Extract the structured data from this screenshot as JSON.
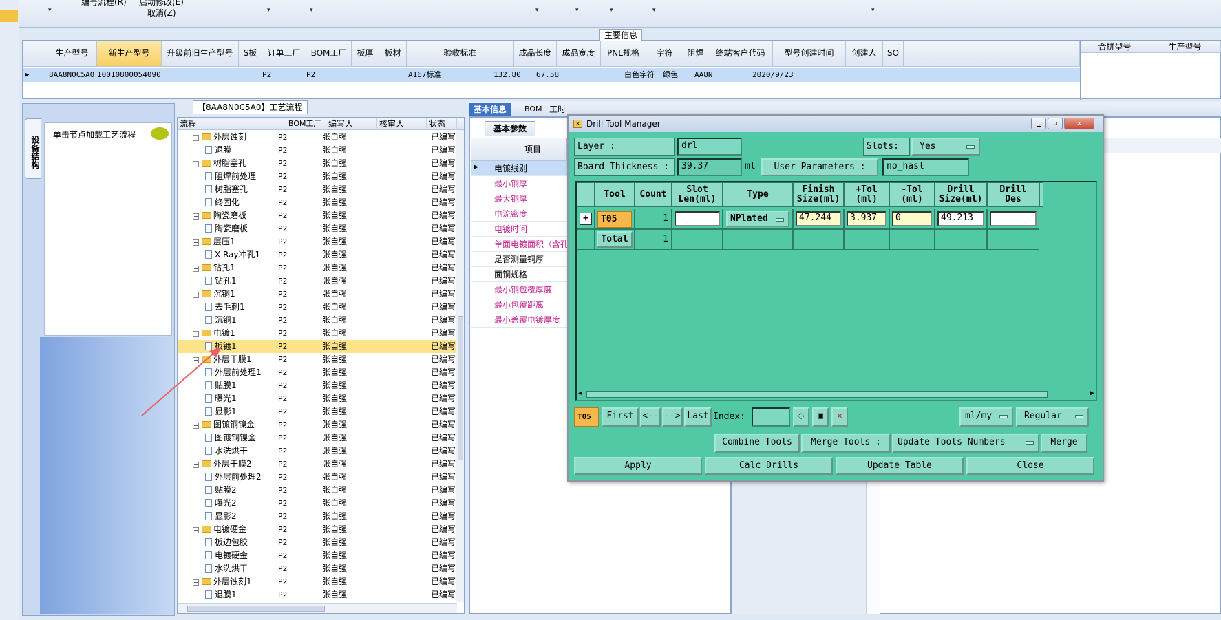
{
  "top": {
    "labels": [
      "编号流程(R)",
      "启动修改(E)",
      "取消(Z)"
    ]
  },
  "main_info": {
    "title": "主要信息",
    "columns": [
      "生产型号",
      "新生产型号",
      "升级前旧生产型号",
      "S板",
      "订单工厂",
      "BOM工厂",
      "板厚",
      "板材",
      "验收标准",
      "成品长度",
      "成品宽度",
      "PNL规格",
      "字符",
      "阻焊",
      "终端客户代码",
      "型号创建时间",
      "创建人",
      "SO"
    ],
    "row": {
      "model": "8AA8N0C5A0",
      "new_model": "10010800054090",
      "order_factory": "P2",
      "bom_factory": "P2",
      "standard": "A167标准",
      "length": "132.80",
      "width": "67.58",
      "char": "白色字符",
      "solder": "绿色",
      "customer": "AA8N",
      "created": "2020/9/23"
    },
    "right_columns": [
      "合拼型号",
      "生产型号"
    ]
  },
  "left_panel": {
    "vtab": "设备结构",
    "hint": "单击节点加载工艺流程"
  },
  "process": {
    "title": "【8AA8N0C5A0】工艺流程",
    "headers": [
      "流程",
      "BOM工厂",
      "编写人",
      "核审人",
      "状态"
    ],
    "rows": [
      {
        "name": "外层蚀刻",
        "level": 1,
        "factory": "P2",
        "writer": "张自强",
        "status": "已编写"
      },
      {
        "name": "退膜",
        "level": 2,
        "factory": "P2",
        "writer": "张自强",
        "status": "已编写"
      },
      {
        "name": "树脂塞孔",
        "level": 1,
        "factory": "P2",
        "writer": "张自强",
        "status": "已编写"
      },
      {
        "name": "阻焊前处理",
        "level": 2,
        "factory": "P2",
        "writer": "张自强",
        "status": "已编写"
      },
      {
        "name": "树脂塞孔",
        "level": 2,
        "factory": "P2",
        "writer": "张自强",
        "status": "已编写"
      },
      {
        "name": "终固化",
        "level": 2,
        "factory": "P2",
        "writer": "张自强",
        "status": "已编写"
      },
      {
        "name": "陶瓷磨板",
        "level": 1,
        "factory": "P2",
        "writer": "张自强",
        "status": "已编写"
      },
      {
        "name": "陶瓷磨板",
        "level": 2,
        "factory": "P2",
        "writer": "张自强",
        "status": "已编写"
      },
      {
        "name": "层压1",
        "level": 1,
        "factory": "P2",
        "writer": "张自强",
        "status": "已编写"
      },
      {
        "name": "X-Ray冲孔1",
        "level": 2,
        "factory": "P2",
        "writer": "张自强",
        "status": "已编写"
      },
      {
        "name": "钻孔1",
        "level": 1,
        "factory": "P2",
        "writer": "张自强",
        "status": "已编写"
      },
      {
        "name": "钻孔1",
        "level": 2,
        "factory": "P2",
        "writer": "张自强",
        "status": "已编写"
      },
      {
        "name": "沉铜1",
        "level": 1,
        "factory": "P2",
        "writer": "张自强",
        "status": "已编写"
      },
      {
        "name": "去毛刺1",
        "level": 2,
        "factory": "P2",
        "writer": "张自强",
        "status": "已编写"
      },
      {
        "name": "沉铜1",
        "level": 2,
        "factory": "P2",
        "writer": "张自强",
        "status": "已编写"
      },
      {
        "name": "电镀1",
        "level": 1,
        "factory": "P2",
        "writer": "张自强",
        "status": "已编写"
      },
      {
        "name": "板镀1",
        "level": 2,
        "factory": "P2",
        "writer": "张自强",
        "status": "已编写",
        "selected": true
      },
      {
        "name": "外层干膜1",
        "level": 1,
        "factory": "P2",
        "writer": "张自强",
        "status": "已编写"
      },
      {
        "name": "外层前处理1",
        "level": 2,
        "factory": "P2",
        "writer": "张自强",
        "status": "已编写"
      },
      {
        "name": "贴膜1",
        "level": 2,
        "factory": "P2",
        "writer": "张自强",
        "status": "已编写"
      },
      {
        "name": "曝光1",
        "level": 2,
        "factory": "P2",
        "writer": "张自强",
        "status": "已编写"
      },
      {
        "name": "显影1",
        "level": 2,
        "factory": "P2",
        "writer": "张自强",
        "status": "已编写"
      },
      {
        "name": "图镀铜镍金",
        "level": 1,
        "factory": "P2",
        "writer": "张自强",
        "status": "已编写"
      },
      {
        "name": "图镀铜镍金",
        "level": 2,
        "factory": "P2",
        "writer": "张自强",
        "status": "已编写"
      },
      {
        "name": "水洗烘干",
        "level": 2,
        "factory": "P2",
        "writer": "张自强",
        "status": "已编写"
      },
      {
        "name": "外层干膜2",
        "level": 1,
        "factory": "P2",
        "writer": "张自强",
        "status": "已编写"
      },
      {
        "name": "外层前处理2",
        "level": 2,
        "factory": "P2",
        "writer": "张自强",
        "status": "已编写"
      },
      {
        "name": "贴膜2",
        "level": 2,
        "factory": "P2",
        "writer": "张自强",
        "status": "已编写"
      },
      {
        "name": "曝光2",
        "level": 2,
        "factory": "P2",
        "writer": "张自强",
        "status": "已编写"
      },
      {
        "name": "显影2",
        "level": 2,
        "factory": "P2",
        "writer": "张自强",
        "status": "已编写"
      },
      {
        "name": "电镀硬金",
        "level": 1,
        "factory": "P2",
        "writer": "张自强",
        "status": "已编写"
      },
      {
        "name": "板边包胶",
        "level": 2,
        "factory": "P2",
        "writer": "张自强",
        "status": "已编写"
      },
      {
        "name": "电镀硬金",
        "level": 2,
        "factory": "P2",
        "writer": "张自强",
        "status": "已编写"
      },
      {
        "name": "水洗烘干",
        "level": 2,
        "factory": "P2",
        "writer": "张自强",
        "status": "已编写"
      },
      {
        "name": "外层蚀刻1",
        "level": 1,
        "factory": "P2",
        "writer": "张自强",
        "status": "已编写"
      },
      {
        "name": "退膜1",
        "level": 2,
        "factory": "P2",
        "writer": "张自强",
        "status": "已编写"
      }
    ]
  },
  "mid": {
    "tabs": [
      "基本信息",
      "BOM",
      "工时"
    ],
    "sub_tab": "基本参数",
    "item_header": "项目",
    "props": [
      {
        "label": "电镀线别",
        "red": false,
        "selected": true
      },
      {
        "label": "最小铜厚",
        "red": true
      },
      {
        "label": "最大铜厚",
        "red": true
      },
      {
        "label": "电流密度",
        "red": true
      },
      {
        "label": "电镀时间",
        "red": true
      },
      {
        "label": "单面电镀面积（含孔",
        "red": true
      },
      {
        "label": "是否测量铜厚",
        "red": false
      },
      {
        "label": "面铜规格",
        "red": false
      },
      {
        "label": "最小铜包覆厚度",
        "red": true
      },
      {
        "label": "最小包覆距离",
        "red": true
      },
      {
        "label": "最小盖覆电镀厚度",
        "red": true
      }
    ]
  },
  "dtm": {
    "title": "Drill Tool Manager",
    "layer_label": "Layer          :",
    "layer_value": "drl",
    "slots_label": "Slots:",
    "slots_value": "Yes",
    "thickness_label": "Board Thickness :",
    "thickness_value": "39.37",
    "thickness_unit": "ml",
    "user_params_label": "User Parameters :",
    "user_params_value": "no_hasl",
    "columns": [
      "Tool",
      "Count",
      "Slot\nLen(ml)",
      "Type",
      "Finish\nSize(ml)",
      "+Tol\n(ml)",
      "-Tol\n(ml)",
      "Drill\nSize(ml)",
      "Drill\nDes"
    ],
    "row": {
      "tool": "T05",
      "count": "1",
      "slot_len": "",
      "type": "NPlated",
      "finish": "47.244",
      "plus_tol": "3.937",
      "minus_tol": "0",
      "drill": "49.213",
      "des": ""
    },
    "total_label": "Total",
    "total_count": "1",
    "nav": {
      "current": "T05",
      "first": "First",
      "prev": "<--",
      "next": "-->",
      "last": "Last",
      "index_label": "Index:",
      "index_value": "",
      "unit": "ml/my",
      "mode": "Regular"
    },
    "combine_tools": "Combine Tools",
    "merge_tools_label": "Merge Tools :",
    "merge_option": "Update Tools Numbers",
    "merge_button": "Merge",
    "apply": "Apply",
    "calc": "Calc Drills",
    "update": "Update Table",
    "close": "Close"
  }
}
